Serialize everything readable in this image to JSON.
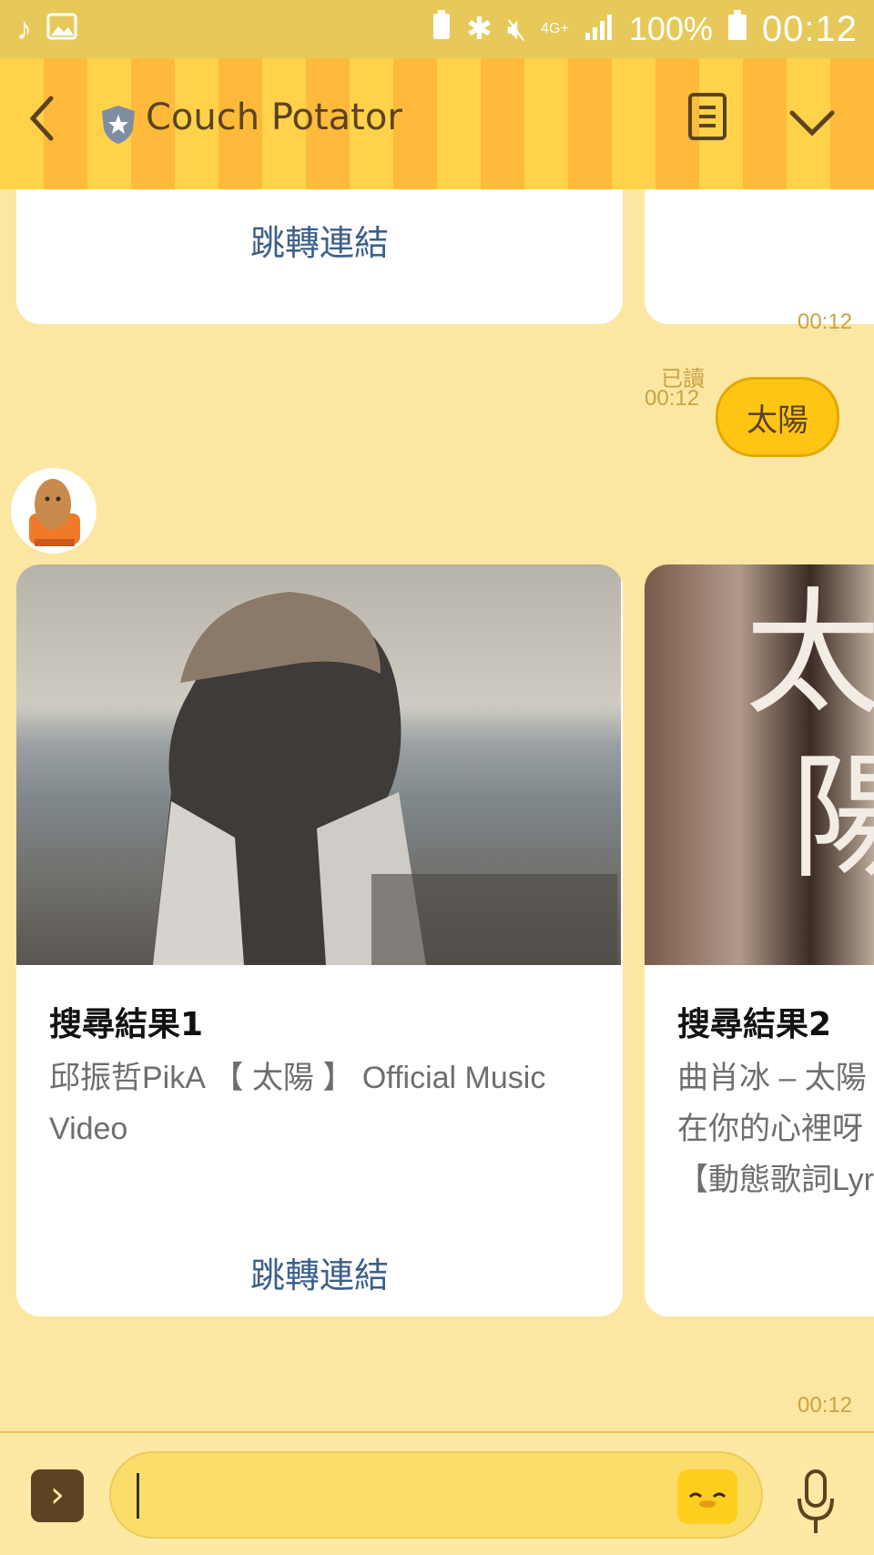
{
  "status_bar": {
    "left_icons": [
      "music-note-icon",
      "image-icon"
    ],
    "battery_percent": "100%",
    "time": "00:12",
    "network": "4G+"
  },
  "header": {
    "title": "Couch Potator"
  },
  "messages": {
    "top_card_link": "跳轉連結",
    "time_after_cards_1": "00:12",
    "read_label": "已讀",
    "user_msg_time": "00:12",
    "user_msg": "太陽",
    "result1": {
      "title": "搜尋結果1",
      "desc": "邱振哲PikA 【 太陽 】 Official Music Video",
      "link": "跳轉連結"
    },
    "result2": {
      "title": "搜尋結果2",
      "desc_line1": "曲肖冰 – 太陽",
      "desc_line2": "在你的心裡呀",
      "desc_line3": "【動態歌詞Lyr"
    },
    "time_after_cards_2": "00:12"
  },
  "colors": {
    "header_stripe_a": "#ffd24a",
    "header_stripe_b": "#ffba3b",
    "link_blue": "#3b5f8a",
    "bubble_yellow": "#ffc515"
  }
}
